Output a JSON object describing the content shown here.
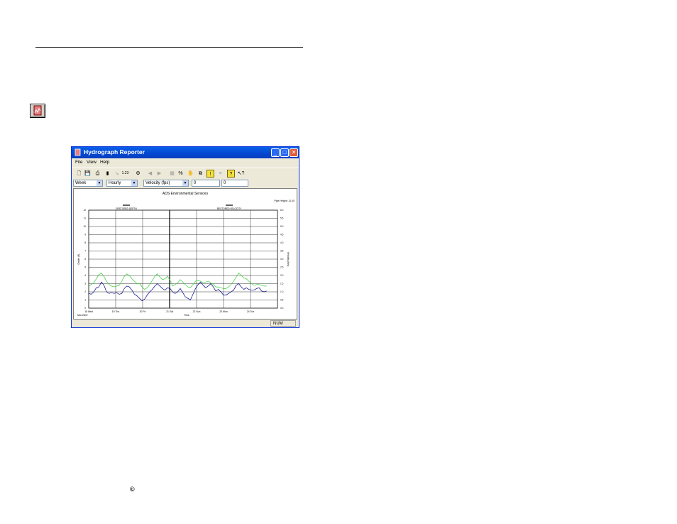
{
  "page": {
    "copyright_symbol": "©"
  },
  "window": {
    "title": "Hydrograph Reporter",
    "buttons": {
      "minimize": "_",
      "maximize": "□",
      "close": "✕"
    }
  },
  "menu": {
    "file": "File",
    "view": "View",
    "help": "Help"
  },
  "toolbar": {
    "buttons": [
      {
        "name": "new-icon",
        "glyph": "🗋",
        "enabled": true
      },
      {
        "name": "save-icon",
        "glyph": "💾",
        "enabled": true
      },
      {
        "name": "print-icon",
        "glyph": "⎙",
        "enabled": true
      },
      {
        "name": "column-chart-icon",
        "glyph": "▮",
        "enabled": true
      },
      {
        "name": "scale-icon",
        "glyph": "↘",
        "enabled": false
      },
      {
        "name": "numbers-icon",
        "glyph": "1.23",
        "enabled": true
      },
      {
        "name": "properties-icon",
        "glyph": "⚙",
        "enabled": true
      },
      {
        "name": "previous-icon",
        "glyph": "◀",
        "enabled": false
      },
      {
        "name": "next-icon",
        "glyph": "▶",
        "enabled": false
      },
      {
        "name": "grid-icon",
        "glyph": "▦",
        "enabled": false
      },
      {
        "name": "percent-icon",
        "glyph": "%",
        "enabled": true
      },
      {
        "name": "hand-icon",
        "glyph": "✋",
        "enabled": false
      },
      {
        "name": "copy-icon",
        "glyph": "⧉",
        "enabled": true
      },
      {
        "name": "alert-icon",
        "glyph": "!",
        "enabled": true
      },
      {
        "name": "filter-icon",
        "glyph": "≡",
        "enabled": false
      },
      {
        "name": "help-icon",
        "glyph": "?",
        "enabled": true
      },
      {
        "name": "context-help-icon",
        "glyph": "↖?",
        "enabled": true
      }
    ]
  },
  "filters": {
    "period": "Week",
    "interval": "Hourly",
    "entity": "Velocity (fps)",
    "field1": "0",
    "field2": "0"
  },
  "status": {
    "num": "NUM"
  },
  "chart_data": {
    "type": "line",
    "title": "ADS Environmental Services",
    "pipe_height": "Pipe Height: 11.00",
    "left_axis_label": "Depth (ft)",
    "right_axis_label": "Velocity (fps)",
    "xlabel": "Time",
    "x_start_label": "Mar 2000",
    "left_ticks": [
      "12",
      "11",
      "10",
      "9",
      "8",
      "7",
      "6",
      "5",
      "4",
      "3",
      "2",
      "1",
      "0"
    ],
    "right_ticks": [
      "6.0",
      "5.5",
      "5.0",
      "4.5",
      "4.0",
      "3.5",
      "3.0",
      "2.5",
      "2.0",
      "1.5",
      "1.0",
      "0.5",
      "0.0"
    ],
    "x_ticks": [
      "18 Wed",
      "19 Thu",
      "20 Fri",
      "21 Sat",
      "22 Sun",
      "23 Mon",
      "24 Tue"
    ],
    "ylim": [
      0,
      12
    ],
    "y2lim": [
      0,
      6
    ],
    "legend": [
      {
        "name": "RESTORED DEPTH",
        "color": "#000000"
      },
      {
        "name": "RESTORED VELOCITY",
        "color": "#000000"
      }
    ],
    "series": [
      {
        "color": "#000080",
        "axis": "left",
        "values": [
          1.8,
          1.7,
          2.0,
          2.5,
          2.6,
          3.2,
          2.8,
          2.0,
          1.8,
          1.9,
          1.8,
          1.9,
          1.7,
          1.8,
          2.4,
          2.7,
          2.6,
          2.2,
          1.7,
          1.5,
          1.2,
          0.9,
          1.1,
          1.6,
          2.0,
          2.3,
          2.7,
          3.0,
          2.7,
          2.4,
          2.2,
          2.5,
          2.4,
          2.0,
          1.8,
          2.0,
          2.4,
          1.9,
          1.4,
          1.2,
          1.0,
          1.7,
          2.4,
          2.9,
          3.2,
          2.8,
          2.5,
          2.7,
          3.0,
          2.6,
          2.1,
          2.3,
          2.0,
          1.6,
          1.6,
          1.8,
          2.0,
          2.2,
          2.8,
          3.0,
          2.6,
          2.3,
          2.5,
          2.3,
          2.2,
          2.2,
          2.4,
          2.5,
          2.1,
          2.0,
          2.1
        ]
      },
      {
        "color": "#33cc33",
        "axis": "left",
        "values": [
          2.7,
          2.9,
          3.1,
          3.6,
          4.1,
          4.3,
          3.9,
          3.3,
          2.9,
          2.7,
          2.6,
          2.7,
          2.8,
          3.3,
          3.9,
          4.2,
          4.0,
          3.6,
          3.3,
          3.0,
          3.0,
          2.6,
          2.3,
          2.5,
          2.9,
          3.4,
          3.9,
          4.2,
          3.8,
          3.5,
          3.6,
          3.9,
          3.4,
          2.7,
          2.9,
          3.1,
          3.5,
          3.2,
          2.9,
          2.6,
          2.5,
          2.9,
          3.3,
          3.4,
          3.3,
          3.1,
          3.2,
          3.3,
          3.1,
          2.9,
          2.6,
          2.6,
          2.5,
          2.4,
          2.4,
          2.6,
          2.9,
          3.3,
          3.8,
          4.3,
          4.0,
          3.7,
          3.6,
          3.3,
          3.0,
          2.8,
          2.9,
          2.9,
          2.8,
          2.7,
          2.7
        ]
      }
    ]
  }
}
